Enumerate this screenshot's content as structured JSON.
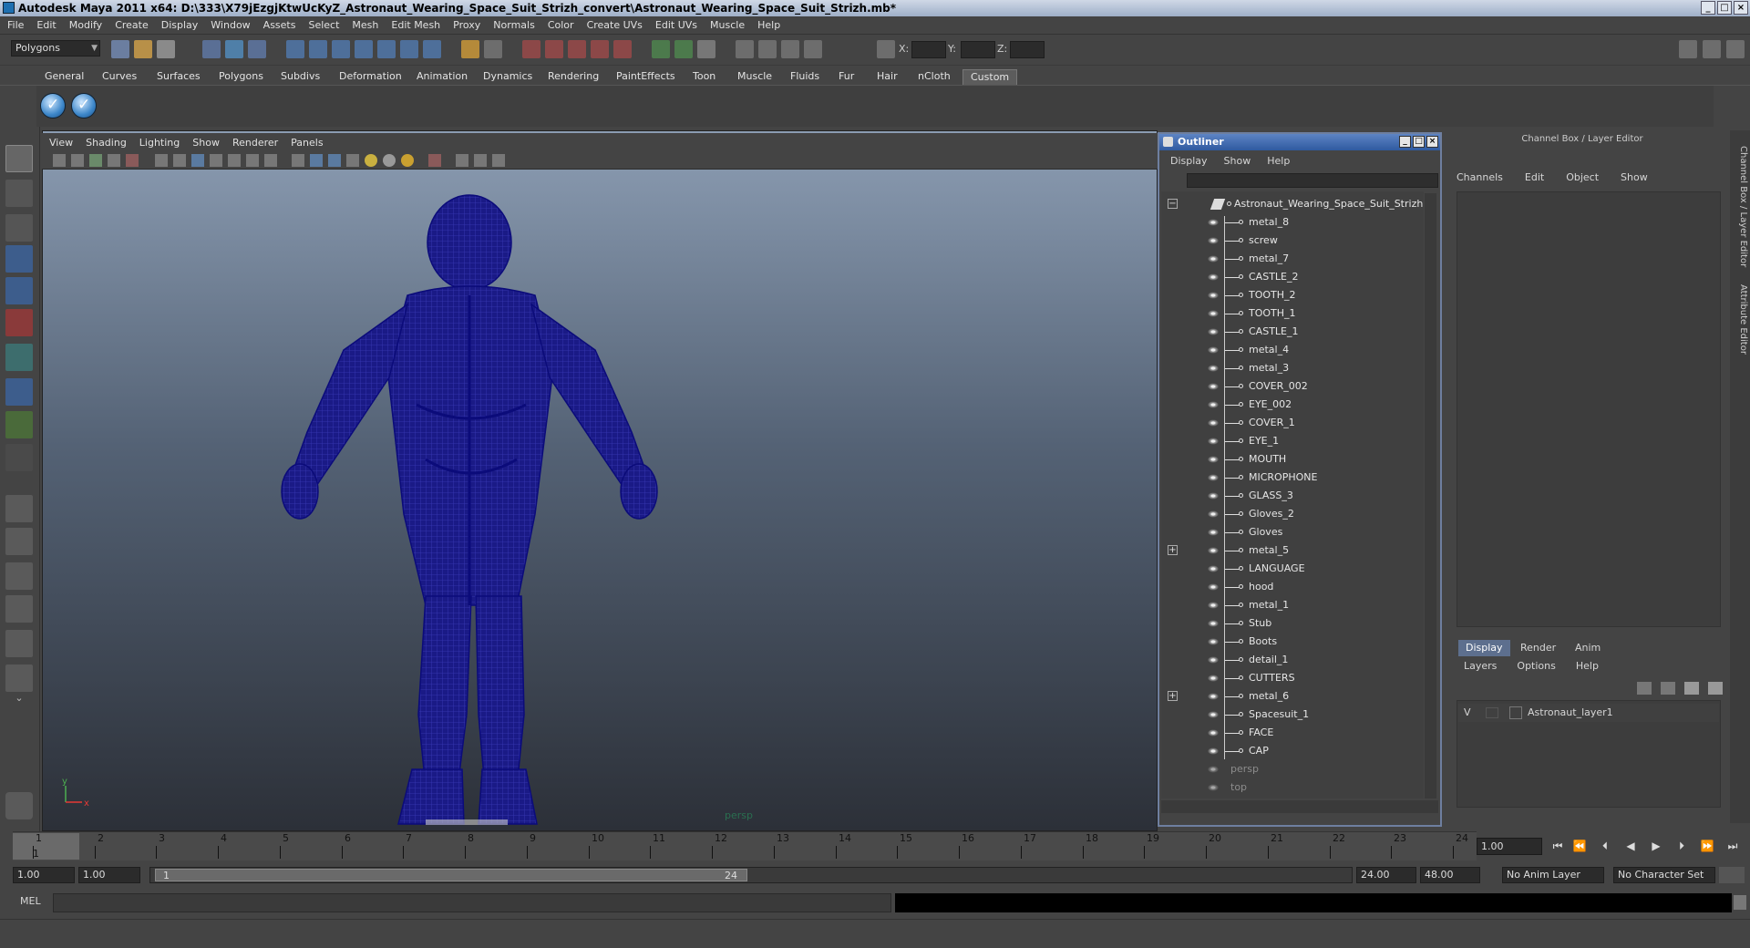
{
  "window": {
    "title": "Autodesk Maya 2011 x64: D:\\333\\X79jEzgjKtwUcKyZ_Astronaut_Wearing_Space_Suit_Strizh_convert\\Astronaut_Wearing_Space_Suit_Strizh.mb*"
  },
  "menubar": [
    "File",
    "Edit",
    "Modify",
    "Create",
    "Display",
    "Window",
    "Assets",
    "Select",
    "Mesh",
    "Edit Mesh",
    "Proxy",
    "Normals",
    "Color",
    "Create UVs",
    "Edit UVs",
    "Muscle",
    "Help"
  ],
  "status_line": {
    "mode": "Polygons",
    "x_label": "X:",
    "y_label": "Y:",
    "z_label": "Z:"
  },
  "shelf": {
    "tabs": [
      "General",
      "Curves",
      "Surfaces",
      "Polygons",
      "Subdivs",
      "Deformation",
      "Animation",
      "Dynamics",
      "Rendering",
      "PaintEffects",
      "Toon",
      "Muscle",
      "Fluids",
      "Fur",
      "Hair",
      "nCloth",
      "Custom"
    ],
    "active_tab": "Custom"
  },
  "viewport": {
    "menu": [
      "View",
      "Shading",
      "Lighting",
      "Show",
      "Renderer",
      "Panels"
    ],
    "camera_label": "persp",
    "axis_x": "x",
    "axis_y": "y",
    "wire_color": "#0b0b7a"
  },
  "outliner": {
    "title": "Outliner",
    "menu": [
      "Display",
      "Show",
      "Help"
    ],
    "root": "Astronaut_Wearing_Space_Suit_Strizh",
    "items": [
      "metal_8",
      "screw",
      "metal_7",
      "CASTLE_2",
      "TOOTH_2",
      "TOOTH_1",
      "CASTLE_1",
      "metal_4",
      "metal_3",
      "COVER_002",
      "EYE_002",
      "COVER_1",
      "EYE_1",
      "MOUTH",
      "MICROPHONE",
      "GLASS_3",
      "Gloves_2",
      "Gloves",
      "metal_5",
      "LANGUAGE",
      "hood",
      "metal_1",
      "Stub",
      "Boots",
      "detail_1",
      "CUTTERS",
      "metal_6",
      "Spacesuit_1",
      "FACE",
      "CAP"
    ],
    "cameras": [
      "persp",
      "top"
    ],
    "expandable": [
      "metal_5",
      "metal_6"
    ]
  },
  "channel_box": {
    "title": "Channel Box / Layer Editor",
    "menu": [
      "Channels",
      "Edit",
      "Object",
      "Show"
    ],
    "layer_tabs": [
      "Display",
      "Render",
      "Anim"
    ],
    "active_layer_tab": "Display",
    "layer_menu": [
      "Layers",
      "Options",
      "Help"
    ],
    "layer": {
      "visible": "V",
      "name": "Astronaut_layer1"
    }
  },
  "side_tabs": [
    "Channel Box / Layer Editor",
    "Attribute Editor"
  ],
  "timeline": {
    "ticks": [
      "1",
      "2",
      "3",
      "4",
      "5",
      "6",
      "7",
      "8",
      "9",
      "10",
      "11",
      "12",
      "13",
      "14",
      "15",
      "16",
      "17",
      "18",
      "19",
      "20",
      "21",
      "22",
      "23",
      "24"
    ],
    "current_frame_marker": "1",
    "current_frame": "1.00"
  },
  "range": {
    "start": "1.00",
    "playback_start": "1.00",
    "slider_start": "1",
    "slider_end": "24",
    "playback_end": "24.00",
    "end": "48.00",
    "anim_layer": "No Anim Layer",
    "character_set": "No Character Set"
  },
  "command_line": {
    "label": "MEL"
  }
}
